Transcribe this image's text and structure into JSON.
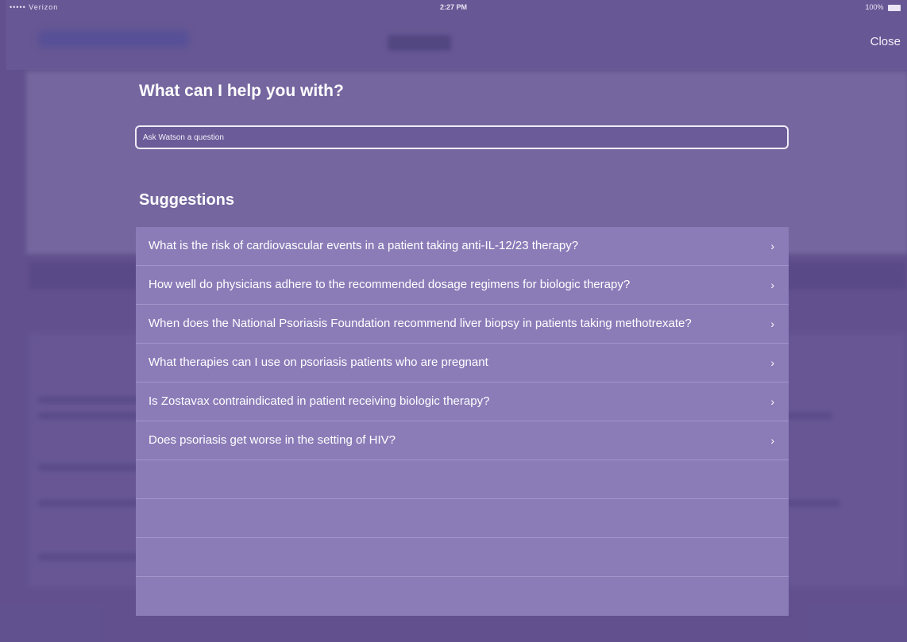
{
  "status_bar": {
    "carrier": "••••• Verizon",
    "time": "2:27 PM",
    "battery": "100%"
  },
  "header": {
    "close_label": "Close"
  },
  "search": {
    "heading": "What can I help you with?",
    "placeholder": "Ask Watson a question"
  },
  "suggestions": {
    "heading": "Suggestions",
    "items": [
      {
        "text": "What is the risk of cardiovascular events in a patient taking anti-IL-12/23 therapy?"
      },
      {
        "text": "How well do physicians adhere to the recommended dosage regimens for biologic therapy?"
      },
      {
        "text": "When does the National Psoriasis Foundation recommend liver biopsy in patients taking methotrexate?"
      },
      {
        "text": "What therapies can I use on psoriasis patients who are pregnant"
      },
      {
        "text": "Is Zostavax contraindicated in patient receiving biologic therapy?"
      },
      {
        "text": "Does psoriasis get worse in the setting of HIV?"
      }
    ],
    "chevron": "›"
  },
  "colors": {
    "overlay": "#64528f",
    "panel": "#8b7cb8",
    "text": "#ffffff"
  }
}
